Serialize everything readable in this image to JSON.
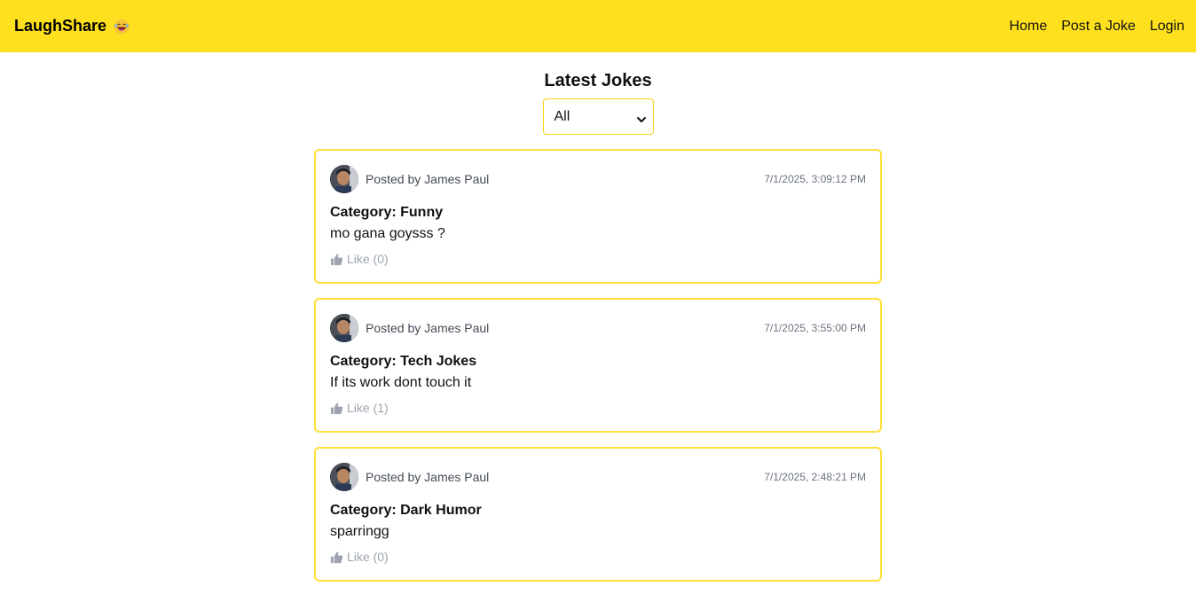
{
  "nav": {
    "brand": "LaughShare",
    "brand_icon": "laughing-face-emoji-icon",
    "links": [
      "Home",
      "Post a Joke",
      "Login"
    ]
  },
  "main": {
    "title": "Latest Jokes",
    "filter": {
      "selected": "All"
    }
  },
  "jokes": [
    {
      "posted_by": "Posted by James Paul",
      "timestamp": "7/1/2025, 3:09:12 PM",
      "category": "Category: Funny",
      "text": "mo gana goysss ?",
      "like": "Like (0)"
    },
    {
      "posted_by": "Posted by James Paul",
      "timestamp": "7/1/2025, 3:55:00 PM",
      "category": "Category: Tech Jokes",
      "text": "If its work dont touch it",
      "like": "Like (1)"
    },
    {
      "posted_by": "Posted by James Paul",
      "timestamp": "7/1/2025, 2:48:21 PM",
      "category": "Category: Dark Humor",
      "text": "sparringg",
      "like": "Like (0)"
    }
  ],
  "colors": {
    "navbar": "#ffe01e",
    "card_border": "#ffe03a",
    "like": "#9ca3af"
  }
}
